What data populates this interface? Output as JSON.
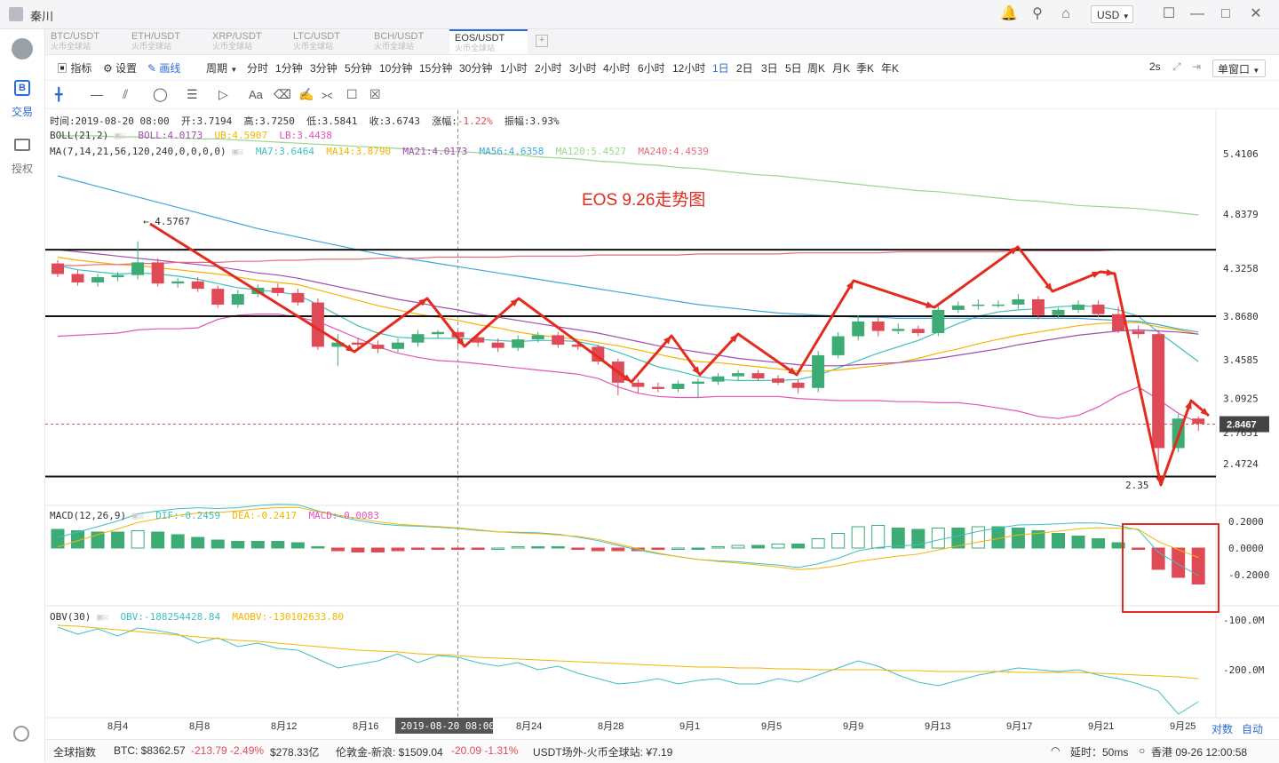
{
  "app": {
    "user": "秦川",
    "currency": "USD"
  },
  "rail": {
    "trade": "交易",
    "auth": "授权"
  },
  "tabs": [
    {
      "pair": "BTC/USDT",
      "exchange": "火币全球站"
    },
    {
      "pair": "ETH/USDT",
      "exchange": "火币全球站"
    },
    {
      "pair": "XRP/USDT",
      "exchange": "火币全球站"
    },
    {
      "pair": "LTC/USDT",
      "exchange": "火币全球站"
    },
    {
      "pair": "BCH/USDT",
      "exchange": "火币全球站"
    },
    {
      "pair": "EOS/USDT",
      "exchange": "火币全球站"
    }
  ],
  "toolbar": {
    "indicator": "指标",
    "settings": "设置",
    "draw": "画线",
    "period": "周期",
    "refresh": "2s",
    "window": "单窗口"
  },
  "periods": [
    "分时",
    "1分钟",
    "3分钟",
    "5分钟",
    "10分钟",
    "15分钟",
    "30分钟",
    "1小时",
    "2小时",
    "3小时",
    "4小时",
    "6小时",
    "12小时",
    "1日",
    "2日",
    "3日",
    "5日",
    "周K",
    "月K",
    "季K",
    "年K"
  ],
  "selected_period": "1日",
  "ohlc": {
    "time": "时间:2019-08-20 08:00",
    "open": "开:3.7194",
    "high": "高:3.7250",
    "low": "低:3.5841",
    "close": "收:3.6743",
    "change_label": "涨幅:",
    "change": "-1.22%",
    "amp_label": "振幅:",
    "amp": "3.93%"
  },
  "boll": {
    "label": "BOLL(21,2)",
    "boll": "BOLL:4.0173",
    "ub": "UB:4.5907",
    "lb": "LB:3.4438"
  },
  "ma": {
    "label": "MA(7,14,21,56,120,240,0,0,0,0)",
    "ma7": "MA7:3.6464",
    "ma14": "MA14:3.8790",
    "ma21": "MA21:4.0173",
    "ma56": "MA56:4.6358",
    "ma120": "MA120:5.4527",
    "ma240": "MA240:4.4539"
  },
  "macd": {
    "label": "MACD(12,26,9)",
    "dif": "DIF:-0.2459",
    "dea": "DEA:-0.2417",
    "macd": "MACD:-0.0083"
  },
  "obv": {
    "label": "OBV(30)",
    "obv": "OBV:-188254428.84",
    "maobv": "MAOBV:-130102633.80"
  },
  "annotation": "EOS 9.26走势图",
  "price_axis": [
    "5.4106",
    "4.8379",
    "4.3258",
    "3.8680",
    "3.4585",
    "3.0925",
    "2.7651",
    "2.4724"
  ],
  "last_price": "2.8467",
  "macd_axis": [
    "0.2000",
    "0.0000",
    "-0.2000"
  ],
  "obv_axis": [
    "-100.0M",
    "-200.0M"
  ],
  "date_axis": [
    "8月4",
    "8月8",
    "8月12",
    "8月16",
    "2019-08-20 08:00:00",
    "8月24",
    "8月28",
    "9月1",
    "9月5",
    "9月9",
    "9月13",
    "9月17",
    "9月21",
    "9月25"
  ],
  "axis_buttons": {
    "log": "对数",
    "auto": "自动"
  },
  "high_marker": "4.5767",
  "low_marker": "2.35",
  "status": {
    "index": "全球指数",
    "btc": "BTC: $8362.57",
    "btc_chg": "-213.79 -2.49%",
    "btc_cap": "$278.33亿",
    "gold": "伦敦金-新浪: $1509.04",
    "gold_chg": "-20.09 -1.31%",
    "usdt": "USDT场外-火币全球站: ¥7.19",
    "latency": "延时：50ms",
    "clock": "香港 09-26 12:00:58"
  },
  "colors": {
    "up": "#3dab74",
    "down": "#e04a56",
    "accent": "#2b6ad8",
    "annotation": "#e32b1f"
  },
  "chart_data": {
    "type": "candlestick",
    "dates": [
      "7/31",
      "8/1",
      "8/2",
      "8/3",
      "8/4",
      "8/5",
      "8/6",
      "8/7",
      "8/8",
      "8/9",
      "8/10",
      "8/11",
      "8/12",
      "8/13",
      "8/14",
      "8/15",
      "8/16",
      "8/17",
      "8/18",
      "8/19",
      "8/20",
      "8/21",
      "8/22",
      "8/23",
      "8/24",
      "8/25",
      "8/26",
      "8/27",
      "8/28",
      "8/29",
      "8/30",
      "8/31",
      "9/1",
      "9/2",
      "9/3",
      "9/4",
      "9/5",
      "9/6",
      "9/7",
      "9/8",
      "9/9",
      "9/10",
      "9/11",
      "9/12",
      "9/13",
      "9/14",
      "9/15",
      "9/16",
      "9/17",
      "9/18",
      "9/19",
      "9/20",
      "9/21",
      "9/22",
      "9/23",
      "9/24",
      "9/25",
      "9/26"
    ],
    "open": [
      4.37,
      4.27,
      4.19,
      4.24,
      4.26,
      4.38,
      4.18,
      4.2,
      4.13,
      3.98,
      4.08,
      4.14,
      4.09,
      4.0,
      3.58,
      3.62,
      3.6,
      3.56,
      3.62,
      3.7,
      3.72,
      3.67,
      3.62,
      3.57,
      3.65,
      3.69,
      3.6,
      3.58,
      3.44,
      3.24,
      3.2,
      3.18,
      3.23,
      3.25,
      3.3,
      3.33,
      3.28,
      3.24,
      3.19,
      3.5,
      3.68,
      3.82,
      3.73,
      3.75,
      3.71,
      3.93,
      3.97,
      3.98,
      3.98,
      4.03,
      3.88,
      3.93,
      3.98,
      3.89,
      3.73,
      3.7,
      2.62,
      2.9
    ],
    "close": [
      4.27,
      4.19,
      4.24,
      4.26,
      4.38,
      4.18,
      4.2,
      4.13,
      3.98,
      4.08,
      4.14,
      4.09,
      4.0,
      3.58,
      3.62,
      3.6,
      3.56,
      3.62,
      3.7,
      3.72,
      3.67,
      3.62,
      3.57,
      3.65,
      3.69,
      3.6,
      3.58,
      3.44,
      3.24,
      3.2,
      3.18,
      3.23,
      3.25,
      3.3,
      3.33,
      3.28,
      3.24,
      3.19,
      3.5,
      3.68,
      3.82,
      3.73,
      3.75,
      3.71,
      3.93,
      3.97,
      3.98,
      3.98,
      4.03,
      3.88,
      3.93,
      3.98,
      3.89,
      3.73,
      3.7,
      2.62,
      2.9,
      2.85
    ],
    "high": [
      4.4,
      4.31,
      4.27,
      4.29,
      4.58,
      4.42,
      4.23,
      4.24,
      4.16,
      4.12,
      4.17,
      4.18,
      4.13,
      4.04,
      3.7,
      3.66,
      3.64,
      3.66,
      3.74,
      3.74,
      3.73,
      3.7,
      3.66,
      3.69,
      3.72,
      3.72,
      3.63,
      3.6,
      3.47,
      3.27,
      3.24,
      3.26,
      3.28,
      3.33,
      3.36,
      3.36,
      3.31,
      3.27,
      3.54,
      3.72,
      3.88,
      3.86,
      3.8,
      3.78,
      3.97,
      4.01,
      4.03,
      4.02,
      4.08,
      4.06,
      3.95,
      4.02,
      4.02,
      3.96,
      3.78,
      3.74,
      2.94,
      2.92
    ],
    "low": [
      4.24,
      4.16,
      4.15,
      4.2,
      4.22,
      4.15,
      4.14,
      4.1,
      3.95,
      3.95,
      4.05,
      4.06,
      3.97,
      3.55,
      3.4,
      3.56,
      3.52,
      3.53,
      3.58,
      3.66,
      3.58,
      3.58,
      3.53,
      3.54,
      3.62,
      3.57,
      3.55,
      3.41,
      3.12,
      3.14,
      3.15,
      3.15,
      3.1,
      3.22,
      3.26,
      3.26,
      3.22,
      3.14,
      3.15,
      3.47,
      3.64,
      3.68,
      3.7,
      3.68,
      3.68,
      3.9,
      3.93,
      3.95,
      3.94,
      3.84,
      3.85,
      3.9,
      3.86,
      3.71,
      3.66,
      2.35,
      2.58,
      2.78
    ],
    "ylim": [
      2.35,
      5.6
    ],
    "price_ticks": [
      5.4106,
      4.8379,
      4.3258,
      3.868,
      3.4585,
      3.0925,
      2.7651,
      2.4724
    ],
    "horizontal_lines": [
      4.5,
      3.87,
      2.35
    ],
    "macd_hist": [
      0.14,
      0.13,
      0.12,
      0.12,
      0.13,
      0.12,
      0.1,
      0.08,
      0.06,
      0.05,
      0.05,
      0.05,
      0.04,
      0.01,
      -0.02,
      -0.03,
      -0.03,
      -0.02,
      -0.01,
      -0.01,
      -0.01,
      -0.01,
      0.0,
      0.01,
      0.01,
      0.01,
      -0.01,
      -0.02,
      -0.02,
      -0.02,
      -0.01,
      0.0,
      0.0,
      0.01,
      0.02,
      0.02,
      0.03,
      0.03,
      0.07,
      0.11,
      0.16,
      0.17,
      0.15,
      0.14,
      0.15,
      0.15,
      0.16,
      0.16,
      0.15,
      0.13,
      0.11,
      0.09,
      0.07,
      0.04,
      -0.01,
      -0.16,
      -0.22,
      -0.27
    ],
    "macd_ylim": [
      -0.3,
      0.22
    ],
    "ma_series": [
      {
        "name": "MA7",
        "color": "#40bfbf",
        "values": [
          4.35,
          4.31,
          4.29,
          4.27,
          4.28,
          4.27,
          4.25,
          4.22,
          4.18,
          4.14,
          4.12,
          4.1,
          4.07,
          3.98,
          3.88,
          3.78,
          3.71,
          3.67,
          3.66,
          3.66,
          3.66,
          3.65,
          3.64,
          3.63,
          3.64,
          3.64,
          3.63,
          3.59,
          3.53,
          3.46,
          3.39,
          3.35,
          3.3,
          3.27,
          3.26,
          3.26,
          3.26,
          3.27,
          3.31,
          3.38,
          3.45,
          3.52,
          3.58,
          3.64,
          3.72,
          3.8,
          3.87,
          3.91,
          3.93,
          3.94,
          3.96,
          3.97,
          3.96,
          3.93,
          3.87,
          3.72,
          3.58,
          3.44
        ]
      },
      {
        "name": "MA14",
        "color": "#f5b400",
        "values": [
          4.43,
          4.4,
          4.38,
          4.36,
          4.35,
          4.33,
          4.31,
          4.29,
          4.27,
          4.24,
          4.21,
          4.19,
          4.17,
          4.12,
          4.07,
          4.02,
          3.97,
          3.93,
          3.89,
          3.86,
          3.83,
          3.79,
          3.76,
          3.72,
          3.69,
          3.67,
          3.65,
          3.62,
          3.59,
          3.55,
          3.51,
          3.47,
          3.44,
          3.43,
          3.41,
          3.39,
          3.37,
          3.35,
          3.35,
          3.36,
          3.38,
          3.4,
          3.43,
          3.47,
          3.52,
          3.56,
          3.61,
          3.65,
          3.69,
          3.72,
          3.75,
          3.78,
          3.8,
          3.81,
          3.81,
          3.77,
          3.74,
          3.7
        ]
      },
      {
        "name": "MA21",
        "color": "#a24bb0",
        "values": [
          4.5,
          4.48,
          4.46,
          4.44,
          4.42,
          4.4,
          4.38,
          4.36,
          4.34,
          4.31,
          4.28,
          4.26,
          4.23,
          4.19,
          4.15,
          4.11,
          4.07,
          4.03,
          4.0,
          3.96,
          3.93,
          3.89,
          3.86,
          3.83,
          3.8,
          3.77,
          3.74,
          3.71,
          3.67,
          3.63,
          3.59,
          3.56,
          3.53,
          3.5,
          3.47,
          3.45,
          3.43,
          3.41,
          3.4,
          3.4,
          3.41,
          3.42,
          3.43,
          3.45,
          3.47,
          3.5,
          3.53,
          3.56,
          3.6,
          3.63,
          3.66,
          3.69,
          3.71,
          3.73,
          3.74,
          3.73,
          3.72,
          3.7
        ]
      },
      {
        "name": "MA56",
        "color": "#3fa8d8",
        "values": [
          5.2,
          5.15,
          5.1,
          5.05,
          5.0,
          4.95,
          4.9,
          4.85,
          4.8,
          4.75,
          4.7,
          4.66,
          4.62,
          4.58,
          4.54,
          4.5,
          4.46,
          4.43,
          4.4,
          4.37,
          4.34,
          4.31,
          4.28,
          4.25,
          4.22,
          4.19,
          4.16,
          4.13,
          4.1,
          4.07,
          4.04,
          4.01,
          3.98,
          3.96,
          3.94,
          3.92,
          3.9,
          3.89,
          3.88,
          3.87,
          3.86,
          3.86,
          3.85,
          3.85,
          3.85,
          3.85,
          3.85,
          3.85,
          3.85,
          3.85,
          3.85,
          3.85,
          3.84,
          3.83,
          3.82,
          3.79,
          3.75,
          3.72
        ]
      },
      {
        "name": "MA120",
        "color": "#9ed68b",
        "values": [
          5.58,
          5.58,
          5.58,
          5.57,
          5.57,
          5.56,
          5.56,
          5.55,
          5.55,
          5.54,
          5.53,
          5.52,
          5.51,
          5.5,
          5.49,
          5.48,
          5.47,
          5.46,
          5.45,
          5.44,
          5.43,
          5.42,
          5.41,
          5.4,
          5.38,
          5.37,
          5.36,
          5.34,
          5.33,
          5.31,
          5.3,
          5.28,
          5.27,
          5.25,
          5.23,
          5.21,
          5.2,
          5.18,
          5.16,
          5.14,
          5.12,
          5.1,
          5.08,
          5.06,
          5.05,
          5.03,
          5.01,
          4.99,
          4.97,
          4.96,
          4.94,
          4.92,
          4.91,
          4.9,
          4.89,
          4.87,
          4.85,
          4.83
        ]
      },
      {
        "name": "MA240",
        "color": "#e86a7a",
        "values": [
          4.35,
          4.35,
          4.36,
          4.36,
          4.37,
          4.37,
          4.38,
          4.38,
          4.38,
          4.39,
          4.39,
          4.4,
          4.4,
          4.41,
          4.41,
          4.41,
          4.42,
          4.42,
          4.42,
          4.43,
          4.43,
          4.43,
          4.43,
          4.44,
          4.44,
          4.44,
          4.44,
          4.45,
          4.45,
          4.45,
          4.45,
          4.45,
          4.46,
          4.46,
          4.46,
          4.46,
          4.46,
          4.47,
          4.47,
          4.47,
          4.47,
          4.47,
          4.48,
          4.48,
          4.48,
          4.48,
          4.48,
          4.48,
          4.49,
          4.49,
          4.49,
          4.49,
          4.49,
          4.5,
          4.5,
          4.5,
          4.5,
          4.5
        ]
      },
      {
        "name": "LB",
        "color": "#e056b8",
        "values": [
          3.68,
          3.69,
          3.7,
          3.71,
          3.74,
          3.75,
          3.75,
          3.76,
          3.84,
          3.88,
          3.89,
          3.89,
          3.86,
          3.82,
          3.74,
          3.66,
          3.58,
          3.52,
          3.48,
          3.45,
          3.44,
          3.42,
          3.4,
          3.38,
          3.36,
          3.34,
          3.32,
          3.28,
          3.2,
          3.14,
          3.11,
          3.1,
          3.1,
          3.11,
          3.11,
          3.11,
          3.11,
          3.09,
          3.08,
          3.07,
          3.07,
          3.07,
          3.06,
          3.06,
          3.05,
          3.05,
          3.03,
          3.0,
          2.97,
          2.92,
          2.9,
          2.93,
          3.01,
          3.12,
          3.2,
          3.08,
          2.95,
          2.86
        ]
      }
    ]
  }
}
